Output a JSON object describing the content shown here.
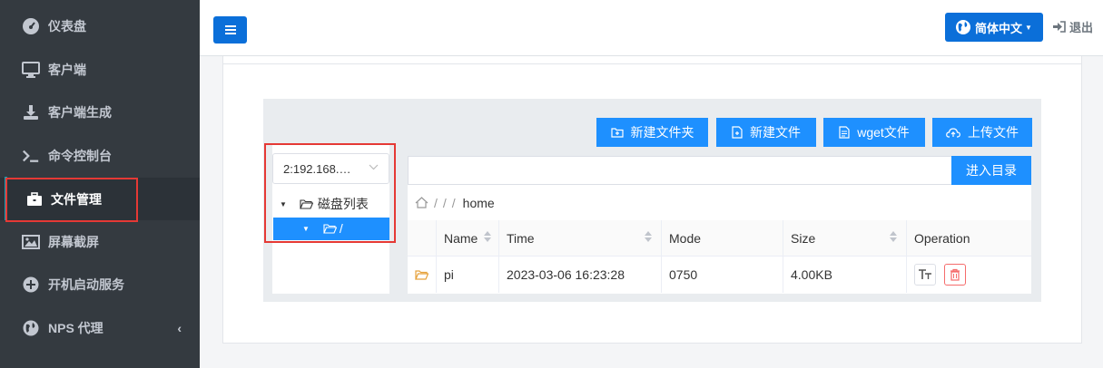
{
  "sidebar": {
    "items": [
      {
        "label": "仪表盘",
        "icon": "dashboard-icon"
      },
      {
        "label": "客户端",
        "icon": "monitor-icon"
      },
      {
        "label": "客户端生成",
        "icon": "download-icon"
      },
      {
        "label": "命令控制台",
        "icon": "terminal-icon"
      },
      {
        "label": "文件管理",
        "icon": "briefcase-icon"
      },
      {
        "label": "屏幕截屏",
        "icon": "image-icon"
      },
      {
        "label": "开机启动服务",
        "icon": "plus-circle-icon"
      },
      {
        "label": "NPS 代理",
        "icon": "globe-icon"
      }
    ],
    "active_index": 4,
    "collapse_glyph": "‹"
  },
  "topbar": {
    "language_label": "简体中文",
    "logout_label": "退出"
  },
  "file_panel": {
    "toolbar": {
      "new_folder": "新建文件夹",
      "new_file": "新建文件",
      "wget_file": "wget文件",
      "upload_file": "上传文件"
    },
    "host_select": "2:192.168.…",
    "tree": {
      "root_label": "磁盘列表",
      "child_label": "/"
    },
    "dir_input": {
      "value": "",
      "button": "进入目录"
    },
    "breadcrumb": {
      "parts": [
        "/",
        "/",
        "/"
      ],
      "current": "home"
    },
    "table": {
      "headers": {
        "name": "Name",
        "time": "Time",
        "mode": "Mode",
        "size": "Size",
        "operation": "Operation"
      },
      "rows": [
        {
          "name": "pi",
          "time": "2023-03-06 16:23:28",
          "mode": "0750",
          "size": "4.00KB",
          "type": "folder"
        }
      ]
    }
  },
  "colors": {
    "sidebar_bg": "#343a40",
    "primary": "#1e90ff",
    "topbar_primary": "#0b6fd9",
    "highlight_box": "#e53935"
  }
}
